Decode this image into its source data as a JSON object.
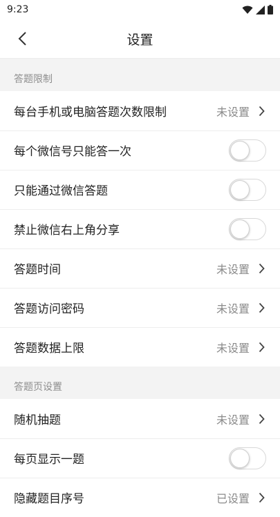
{
  "status": {
    "time": "9:23"
  },
  "header": {
    "title": "设置"
  },
  "sections": [
    {
      "title": "答题限制",
      "items": [
        {
          "label": "每台手机或电脑答题次数限制",
          "value": "未设置"
        },
        {
          "label": "每个微信号只能答一次",
          "toggle": false
        },
        {
          "label": "只能通过微信答题",
          "toggle": false
        },
        {
          "label": "禁止微信右上角分享",
          "toggle": false
        },
        {
          "label": "答题时间",
          "value": "未设置"
        },
        {
          "label": "答题访问密码",
          "value": "未设置"
        },
        {
          "label": "答题数据上限",
          "value": "未设置"
        }
      ]
    },
    {
      "title": "答题页设置",
      "items": [
        {
          "label": "随机抽题",
          "value": "未设置"
        },
        {
          "label": "每页显示一题",
          "toggle": false
        },
        {
          "label": "隐藏题目序号",
          "value": "已设置"
        }
      ]
    }
  ]
}
